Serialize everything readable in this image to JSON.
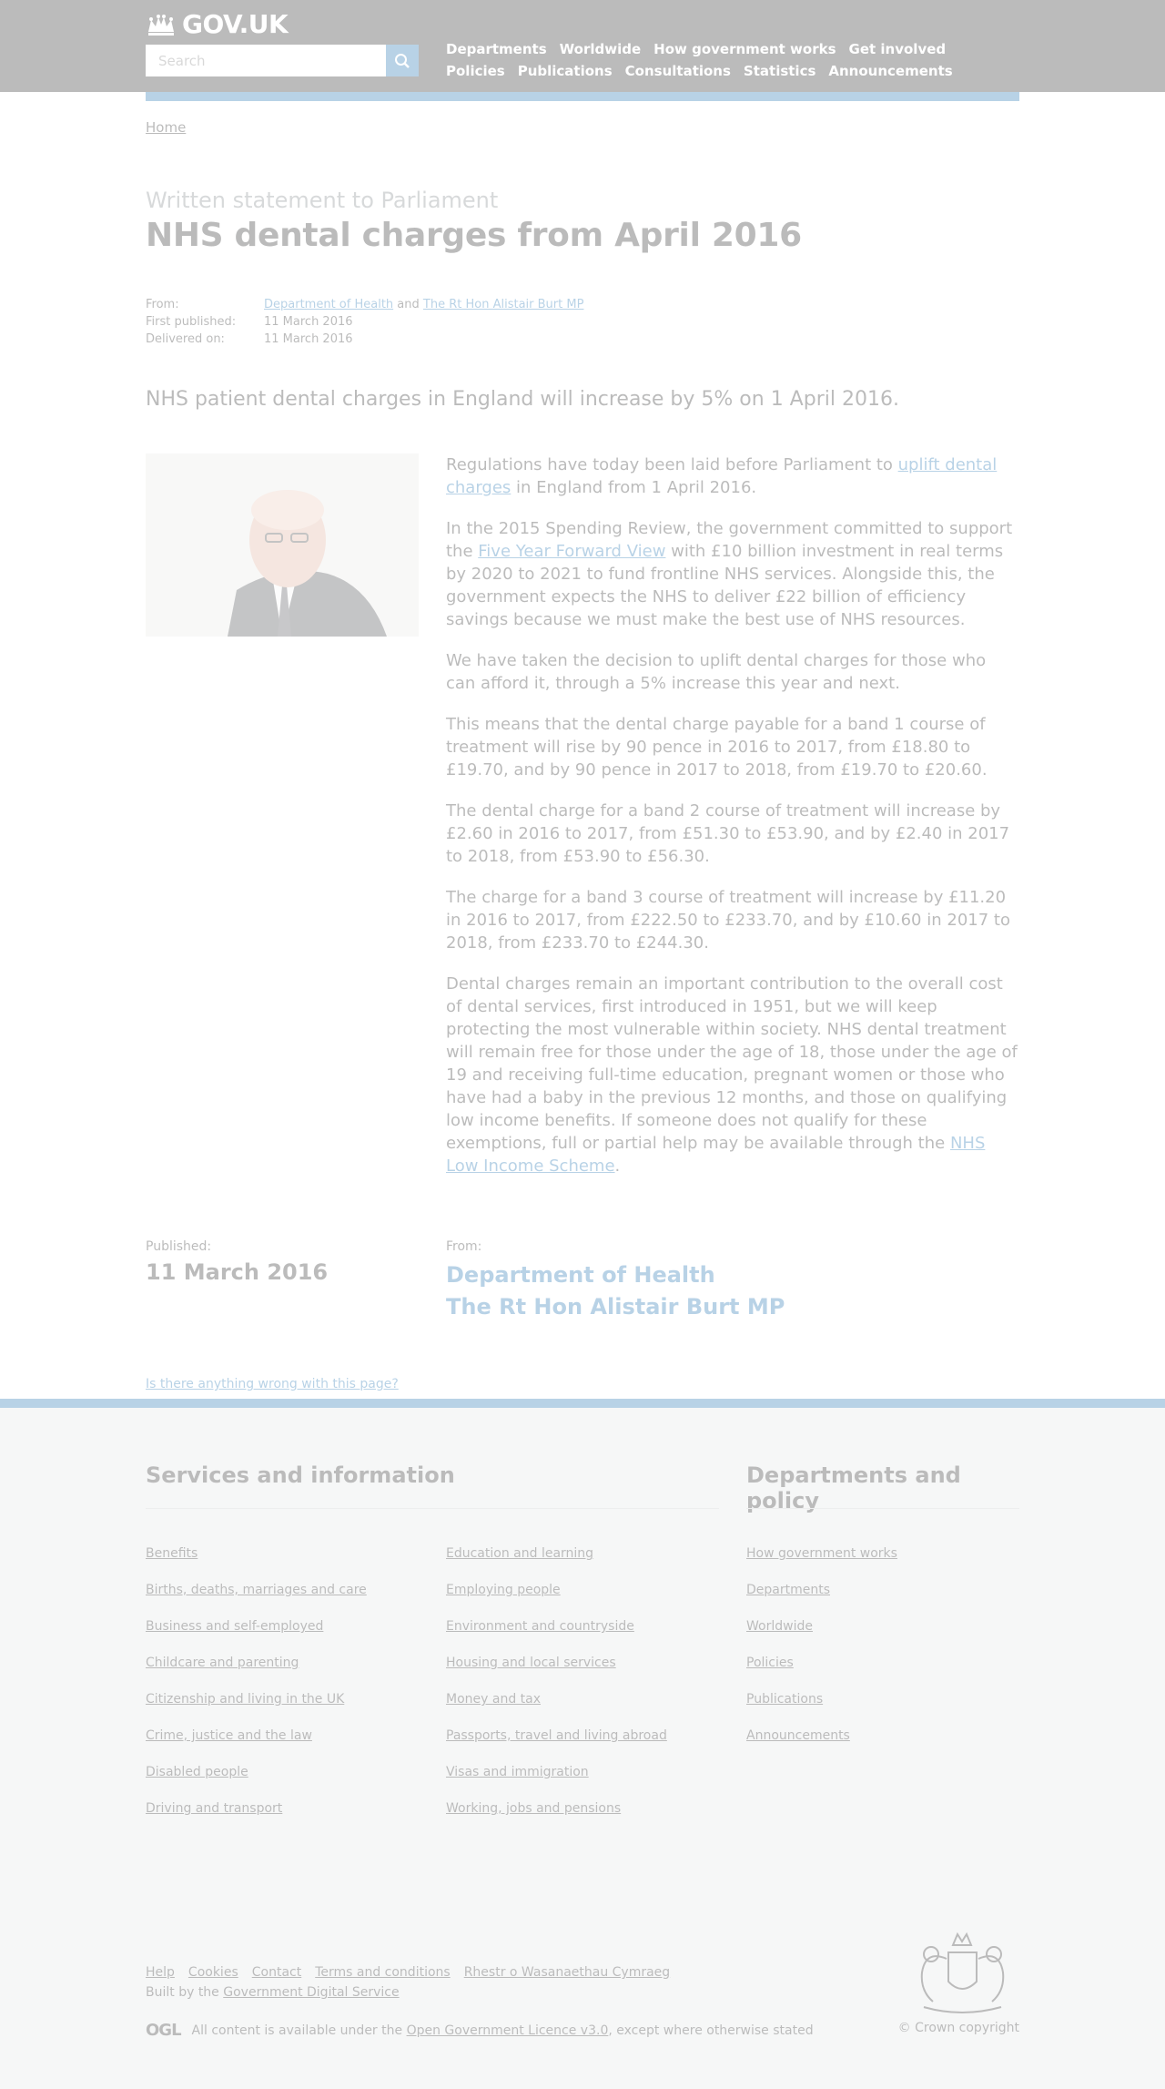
{
  "header": {
    "logo_text": "GOV.UK",
    "search_placeholder": "Search",
    "nav": [
      "Departments",
      "Worldwide",
      "How government works",
      "Get involved",
      "Policies",
      "Publications",
      "Consultations",
      "Statistics",
      "Announcements"
    ]
  },
  "breadcrumb": {
    "home": "Home"
  },
  "title": {
    "context": "Written statement to Parliament",
    "heading": "NHS dental charges from April 2016"
  },
  "meta": {
    "from_label": "From:",
    "from_org": "Department of Health",
    "from_and": "and",
    "from_person": "The Rt Hon Alistair Burt MP",
    "first_published_label": "First published:",
    "first_published": "11 March 2016",
    "delivered_label": "Delivered on:",
    "delivered": "11 March 2016"
  },
  "lead": "NHS patient dental charges in England will increase by 5% on 1 April 2016.",
  "body": {
    "p1_a": "Regulations have today been laid before Parliament to ",
    "p1_link": "uplift dental charges",
    "p1_b": " in England from 1 April 2016.",
    "p2_a": "In the 2015 Spending Review, the government committed to support the ",
    "p2_link": "Five Year Forward View",
    "p2_b": " with £10 billion investment in real terms by 2020 to 2021 to fund frontline NHS services. Alongside this, the government expects the NHS to deliver £22 billion of efficiency savings because we must make the best use of NHS resources.",
    "p3": "We have taken the decision to uplift dental charges for those who can afford it, through a 5% increase this year and next.",
    "p4": "This means that the dental charge payable for a band 1 course of treatment will rise by 90 pence in 2016 to 2017, from £18.80 to £19.70, and by 90 pence in 2017 to 2018, from £19.70 to £20.60.",
    "p5": "The dental charge for a band 2 course of treatment will increase by £2.60 in 2016 to 2017, from £51.30 to £53.90, and by £2.40 in 2017 to 2018, from £53.90 to £56.30.",
    "p6": "The charge for a band 3 course of treatment will increase by £11.20 in 2016 to 2017, from £222.50 to £233.70, and by £10.60 in 2017 to 2018, from £233.70 to £244.30.",
    "p7_a": "Dental charges remain an important contribution to the overall cost of dental services, first introduced in 1951, but we will keep protecting the most vulnerable within society. NHS dental treatment will remain free for those under the age of 18, those under the age of 19 and receiving full-time education, pregnant women or those who have had a baby in the previous 12 months, and those on qualifying low income benefits. If someone does not qualify for these exemptions, full or partial help may be available through the ",
    "p7_link": "NHS Low Income Scheme",
    "p7_b": "."
  },
  "published": {
    "published_label": "Published:",
    "date": "11 March 2016",
    "from_label": "From:",
    "org": "Department of Health",
    "person": "The Rt Hon Alistair Burt MP"
  },
  "report_link": "Is there anything wrong with this page?",
  "footer": {
    "services_heading": "Services and information",
    "departments_heading": "Departments and policy",
    "col1": [
      "Benefits",
      "Births, deaths, marriages and care",
      "Business and self-employed",
      "Childcare and parenting",
      "Citizenship and living in the UK",
      "Crime, justice and the law",
      "Disabled people",
      "Driving and transport"
    ],
    "col2": [
      "Education and learning",
      "Employing people",
      "Environment and countryside",
      "Housing and local services",
      "Money and tax",
      "Passports, travel and living abroad",
      "Visas and immigration",
      "Working, jobs and pensions"
    ],
    "col3": [
      "How government works",
      "Departments",
      "Worldwide",
      "Policies",
      "Publications",
      "Announcements"
    ],
    "meta_links": [
      "Help",
      "Cookies",
      "Contact",
      "Terms and conditions",
      "Rhestr o Wasanaethau Cymraeg"
    ],
    "built_by": "Built by the ",
    "built_by_link": "Government Digital Service",
    "ogl": "OGL",
    "licence_a": "All content is available under the ",
    "licence_link": "Open Government Licence v3.0",
    "licence_b": ", except where otherwise stated",
    "copyright": "© Crown copyright"
  }
}
